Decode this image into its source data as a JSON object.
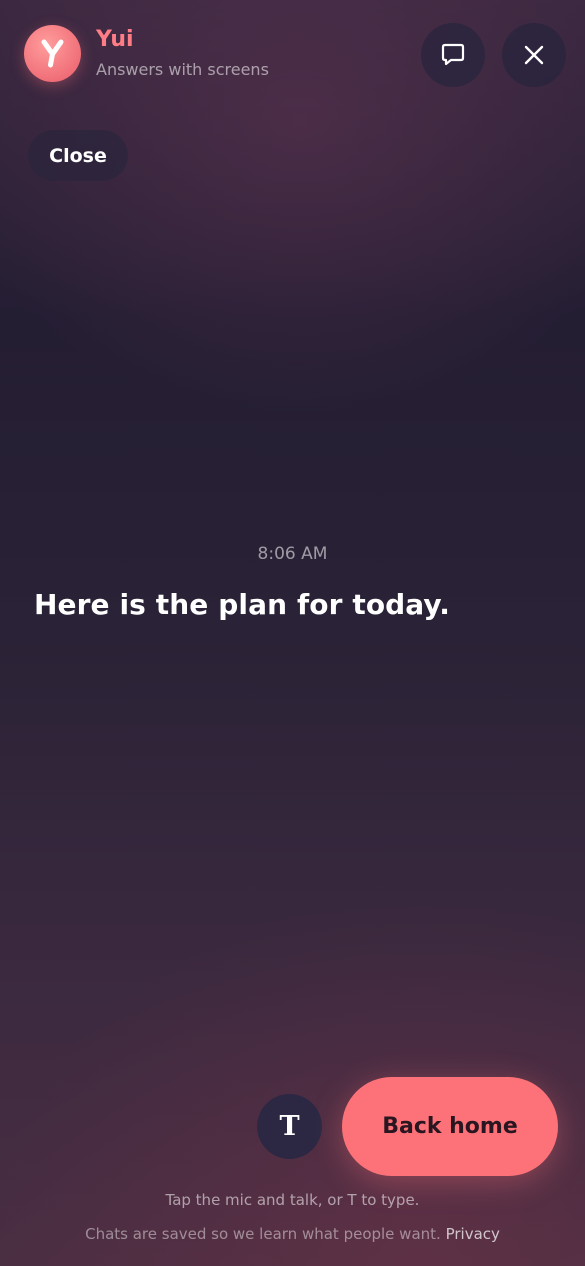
{
  "header": {
    "bot_name": "Yui",
    "bot_subtitle": "Answers with screens",
    "chat_icon": "chat-bubble-icon",
    "close_icon": "close-icon"
  },
  "close_button": {
    "label": "Close"
  },
  "conversation": {
    "timestamp": "8:06 AM",
    "message": "Here is the plan for today."
  },
  "controls": {
    "type_button_label": "T",
    "back_home_label": "Back home"
  },
  "hint": "Tap the mic and talk, or T to type.",
  "footer": {
    "text": "Chats are saved so we learn what people want.",
    "privacy_link": "Privacy"
  },
  "colors": {
    "accent": "#fd7278",
    "bot_name": "#ff7d86",
    "button_dark": "#2c2843"
  }
}
